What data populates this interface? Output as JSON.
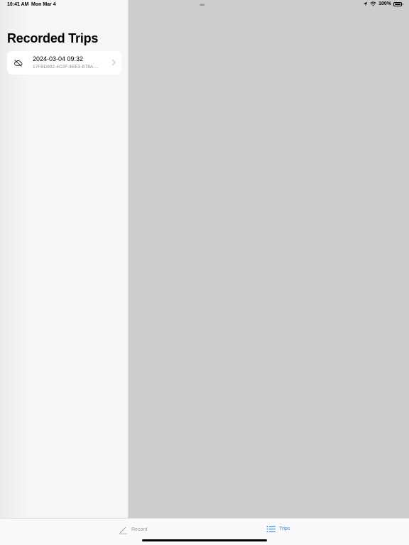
{
  "status_bar": {
    "time": "10:41 AM",
    "date": "Mon Mar 4",
    "battery_text": "100%",
    "battery_level": 1.0
  },
  "sidebar": {
    "title": "Recorded Trips",
    "trips": [
      {
        "title": "2024-03-04 09:32",
        "subtitle": "17FBD892-4C2F-4EE3-B78A-...",
        "icon": "cloud-off-icon"
      }
    ]
  },
  "tab_bar": {
    "tabs": [
      {
        "label": "Record",
        "icon": "pencil-icon",
        "selected": false
      },
      {
        "label": "Trips",
        "icon": "list-icon",
        "selected": true
      }
    ]
  },
  "colors": {
    "accent": "#2b7fd8",
    "detail_background": "#cdcdcd",
    "sidebar_background": "#f6f6f6"
  }
}
